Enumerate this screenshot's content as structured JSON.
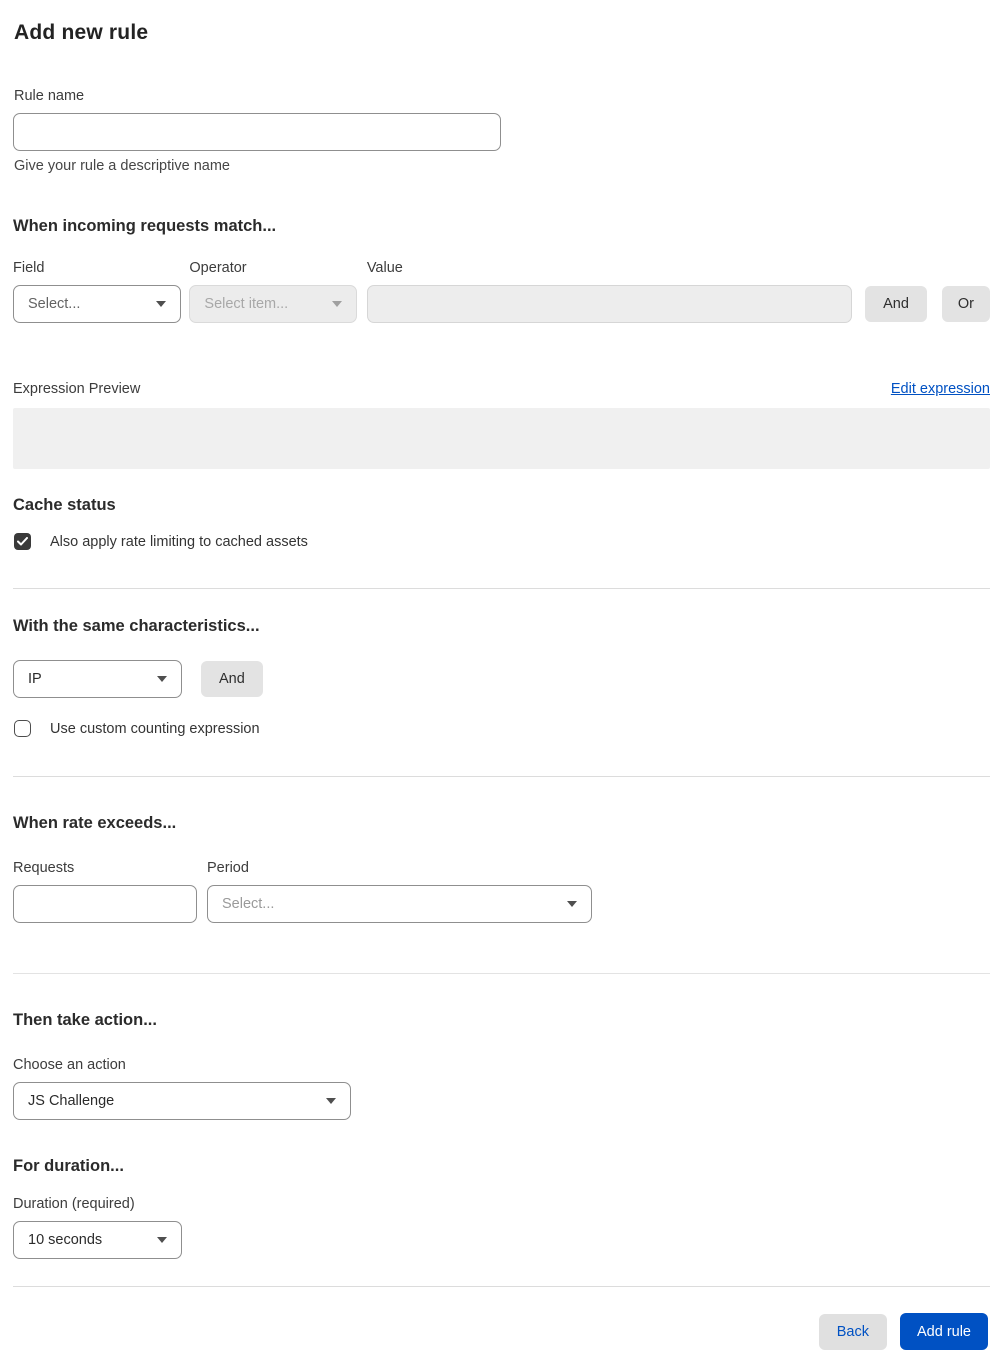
{
  "page": {
    "title": "Add new rule"
  },
  "colors": {
    "accent_blue": "#0051c3",
    "button_gray": "#e3e3e3",
    "disabled_bg": "#ececec",
    "preview_bg": "#f0f0f0",
    "checkbox_dark": "#3a3a3a"
  },
  "rule_name": {
    "label": "Rule name",
    "value": "",
    "helper": "Give your rule a descriptive name"
  },
  "match": {
    "heading": "When incoming requests match...",
    "field": {
      "label": "Field",
      "selected": "Select..."
    },
    "operator": {
      "label": "Operator",
      "selected": "Select item..."
    },
    "value": {
      "label": "Value",
      "value": ""
    },
    "and_button": "And",
    "or_button": "Or"
  },
  "expression": {
    "label": "Expression Preview",
    "edit_link": "Edit expression",
    "preview": ""
  },
  "cache": {
    "heading": "Cache status",
    "checkbox_label": "Also apply rate limiting to cached assets",
    "checked": true
  },
  "characteristics": {
    "heading": "With the same characteristics...",
    "select": "IP",
    "and_button": "And",
    "checkbox_label": "Use custom counting expression",
    "checked": false
  },
  "rate": {
    "heading": "When rate exceeds...",
    "requests": {
      "label": "Requests",
      "value": ""
    },
    "period": {
      "label": "Period",
      "selected": "Select..."
    }
  },
  "action": {
    "heading": "Then take action...",
    "label": "Choose an action",
    "selected": "JS Challenge"
  },
  "duration": {
    "heading": "For duration...",
    "label": "Duration (required)",
    "selected": "10 seconds"
  },
  "footer": {
    "back": "Back",
    "add_rule": "Add rule"
  }
}
